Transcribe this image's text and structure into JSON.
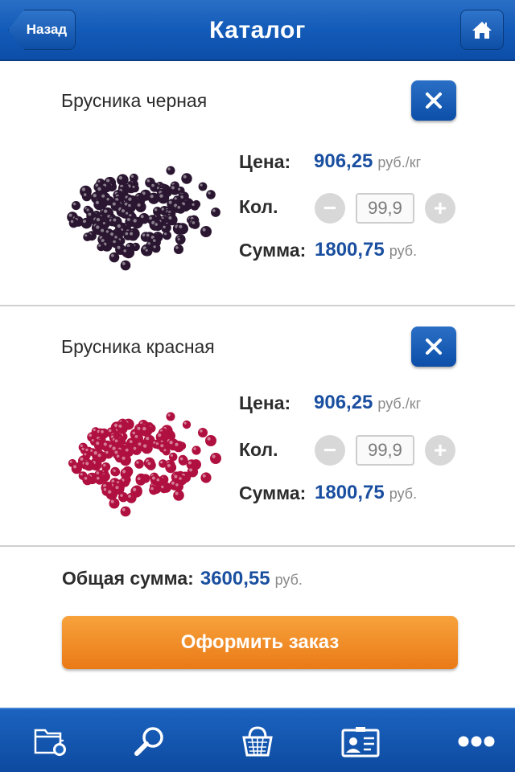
{
  "header": {
    "title": "Каталог",
    "back_label": "Назад",
    "home_icon": "home-icon"
  },
  "products": [
    {
      "name": "Брусника черная",
      "price_label": "Цена:",
      "price": "906,25",
      "price_unit": "руб./кг",
      "qty_label": "Кол.",
      "qty": "99,9",
      "sum_label": "Сумма:",
      "sum": "1800,75",
      "sum_unit": "руб.",
      "berry_color": "#2a1630"
    },
    {
      "name": "Брусника красная",
      "price_label": "Цена:",
      "price": "906,25",
      "price_unit": "руб./кг",
      "qty_label": "Кол.",
      "qty": "99,9",
      "sum_label": "Сумма:",
      "sum": "1800,75",
      "sum_unit": "руб.",
      "berry_color": "#b0103f"
    }
  ],
  "total": {
    "label": "Общая сумма:",
    "value": "3600,55",
    "unit": "руб."
  },
  "order_button": "Оформить заказ",
  "tabbar": {
    "items": [
      "catalog-folder-icon",
      "search-icon",
      "basket-icon",
      "profile-card-icon",
      "more-icon"
    ]
  },
  "colors": {
    "brand_blue": "#135bb8",
    "accent_orange": "#ea7a16",
    "price_blue": "#1a4fa0"
  }
}
